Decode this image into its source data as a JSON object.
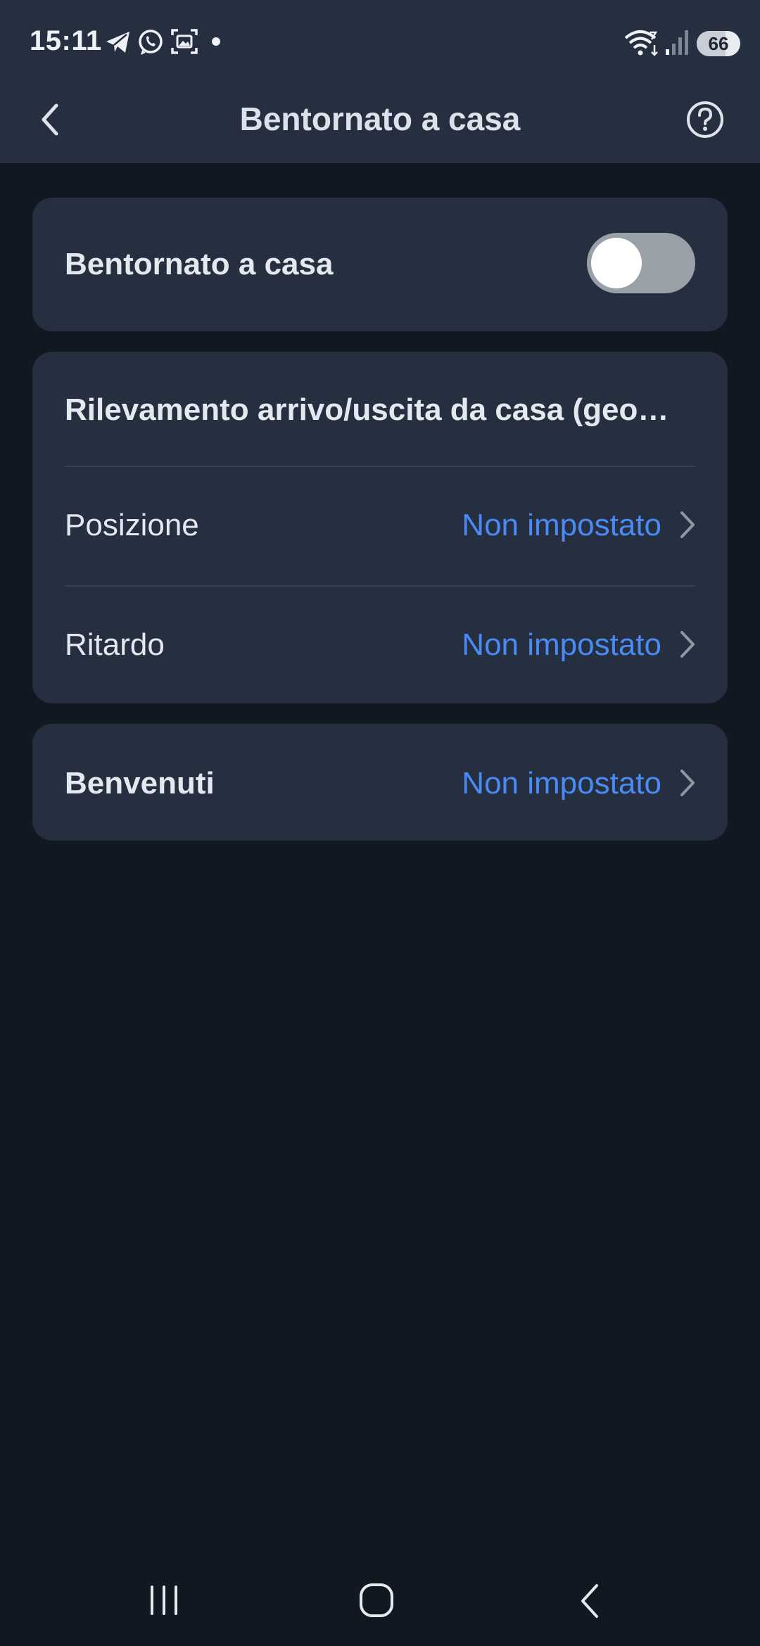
{
  "status_bar": {
    "time": "15:11",
    "battery_level": 66,
    "battery_label": "66",
    "icons": [
      "telegram-icon",
      "whatsapp-icon",
      "screenshot-icon",
      "notification-dot-icon",
      "wifi-icon",
      "signal-icon",
      "battery-icon"
    ]
  },
  "header": {
    "title": "Bentornato a casa",
    "back_icon": "chevron-left-icon",
    "help_icon": "help-circle-icon"
  },
  "settings": {
    "toggle_card": {
      "label": "Bentornato a casa",
      "enabled": false
    },
    "geofence_card": {
      "title": "Rilevamento arrivo/uscita da casa (geo…",
      "rows": [
        {
          "label": "Posizione",
          "value": "Non impostato"
        },
        {
          "label": "Ritardo",
          "value": "Non impostato"
        }
      ]
    },
    "welcome_card": {
      "label": "Benvenuti",
      "value": "Non impostato"
    }
  },
  "colors": {
    "background": "#121822",
    "header": "#252f3f",
    "card": "#262f3f",
    "accent": "#4a8af4",
    "toggle_off": "#9aa0a8"
  },
  "bottom_nav": {
    "icons": [
      "recent-apps-icon",
      "home-icon",
      "back-icon"
    ]
  }
}
